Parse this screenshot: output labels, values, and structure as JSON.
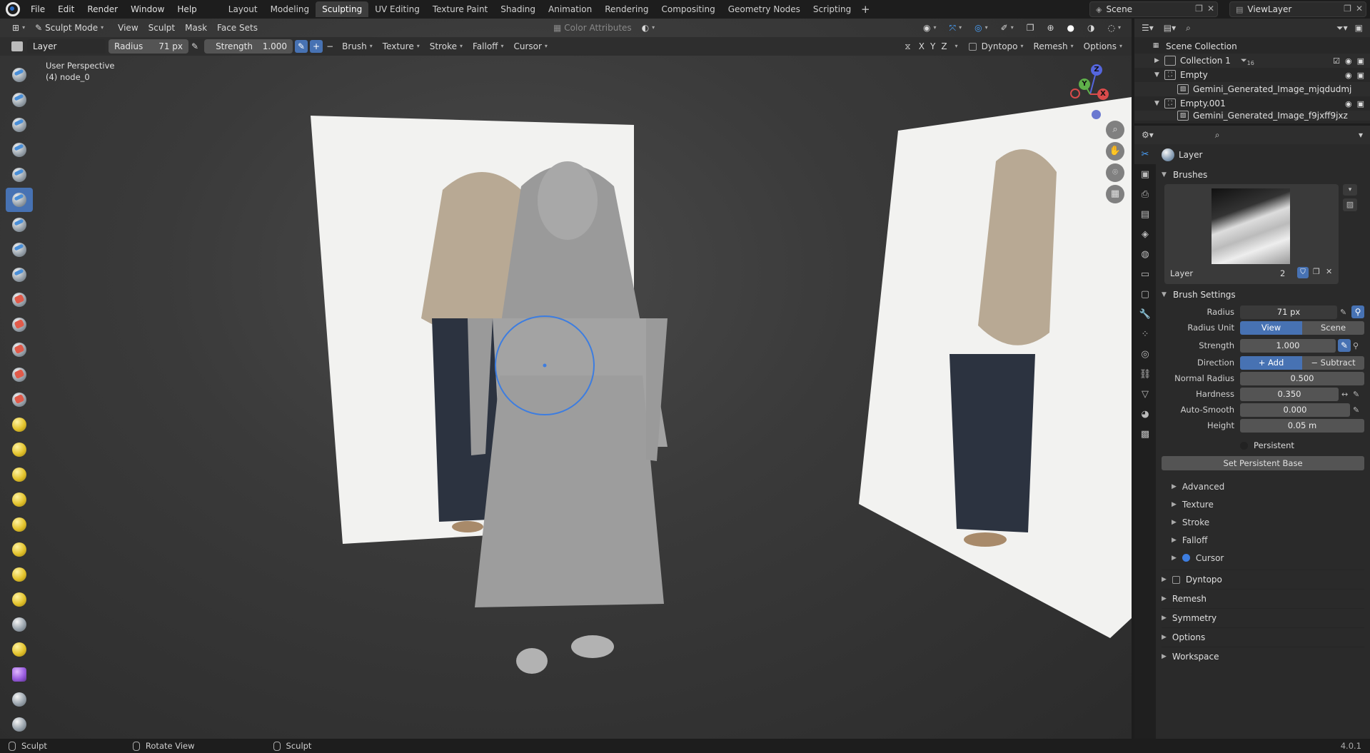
{
  "menu": [
    "File",
    "Edit",
    "Render",
    "Window",
    "Help"
  ],
  "workspaces": [
    "Layout",
    "Modeling",
    "Sculpting",
    "UV Editing",
    "Texture Paint",
    "Shading",
    "Animation",
    "Rendering",
    "Compositing",
    "Geometry Nodes",
    "Scripting"
  ],
  "active_workspace": "Sculpting",
  "scene": {
    "scene_name": "Scene",
    "view_layer": "ViewLayer"
  },
  "viewport": {
    "mode": "Sculpt Mode",
    "menus": [
      "View",
      "Sculpt",
      "Mask",
      "Face Sets"
    ],
    "color_attributes": "Color Attributes",
    "perspective": "User Perspective",
    "object": "(4) node_0"
  },
  "tool_header": {
    "brush": "Layer",
    "radius_label": "Radius",
    "radius_value": "71 px",
    "strength_label": "Strength",
    "strength_value": "1.000",
    "dropdowns": [
      "Brush",
      "Texture",
      "Stroke",
      "Falloff",
      "Cursor"
    ],
    "axes": [
      "X",
      "Y",
      "Z"
    ],
    "right_menus": [
      "Dyntopo",
      "Remesh",
      "Options"
    ]
  },
  "gizmo": {
    "z": "Z",
    "y": "Y",
    "x": "X"
  },
  "outliner": {
    "root": "Scene Collection",
    "items": [
      {
        "name": "Collection 1",
        "badge": "16"
      },
      {
        "name": "Empty"
      },
      {
        "name": "Gemini_Generated_Image_mjqdudmj"
      },
      {
        "name": "Empty.001"
      },
      {
        "name": "Gemini_Generated_Image_f9jxff9jxz"
      }
    ]
  },
  "properties": {
    "brush_name": "Layer",
    "brushes_title": "Brushes",
    "brush_slot_label": "Layer",
    "brush_slot_users": "2",
    "brush_settings_title": "Brush Settings",
    "radius_label": "Radius",
    "radius_value": "71 px",
    "radius_unit_label": "Radius Unit",
    "radius_unit_options": [
      "View",
      "Scene"
    ],
    "strength_label": "Strength",
    "strength_value": "1.000",
    "direction_label": "Direction",
    "direction_options": [
      "Add",
      "Subtract"
    ],
    "normal_radius_label": "Normal Radius",
    "normal_radius_value": "0.500",
    "hardness_label": "Hardness",
    "hardness_value": "0.350",
    "auto_smooth_label": "Auto-Smooth",
    "auto_smooth_value": "0.000",
    "height_label": "Height",
    "height_value": "0.05 m",
    "persistent_label": "Persistent",
    "set_persistent_base": "Set Persistent Base",
    "sub_sections": [
      "Advanced",
      "Texture",
      "Stroke",
      "Falloff",
      "Cursor"
    ],
    "main_sections": [
      "Dyntopo",
      "Remesh",
      "Symmetry",
      "Options",
      "Workspace"
    ]
  },
  "status": {
    "left": "Sculpt",
    "middle": "Rotate View",
    "right": "Sculpt",
    "version": "4.0.1"
  },
  "colors": {
    "accent": "#4772b3",
    "panel": "#2a2a2a",
    "viewport": "#3b3b3b"
  }
}
